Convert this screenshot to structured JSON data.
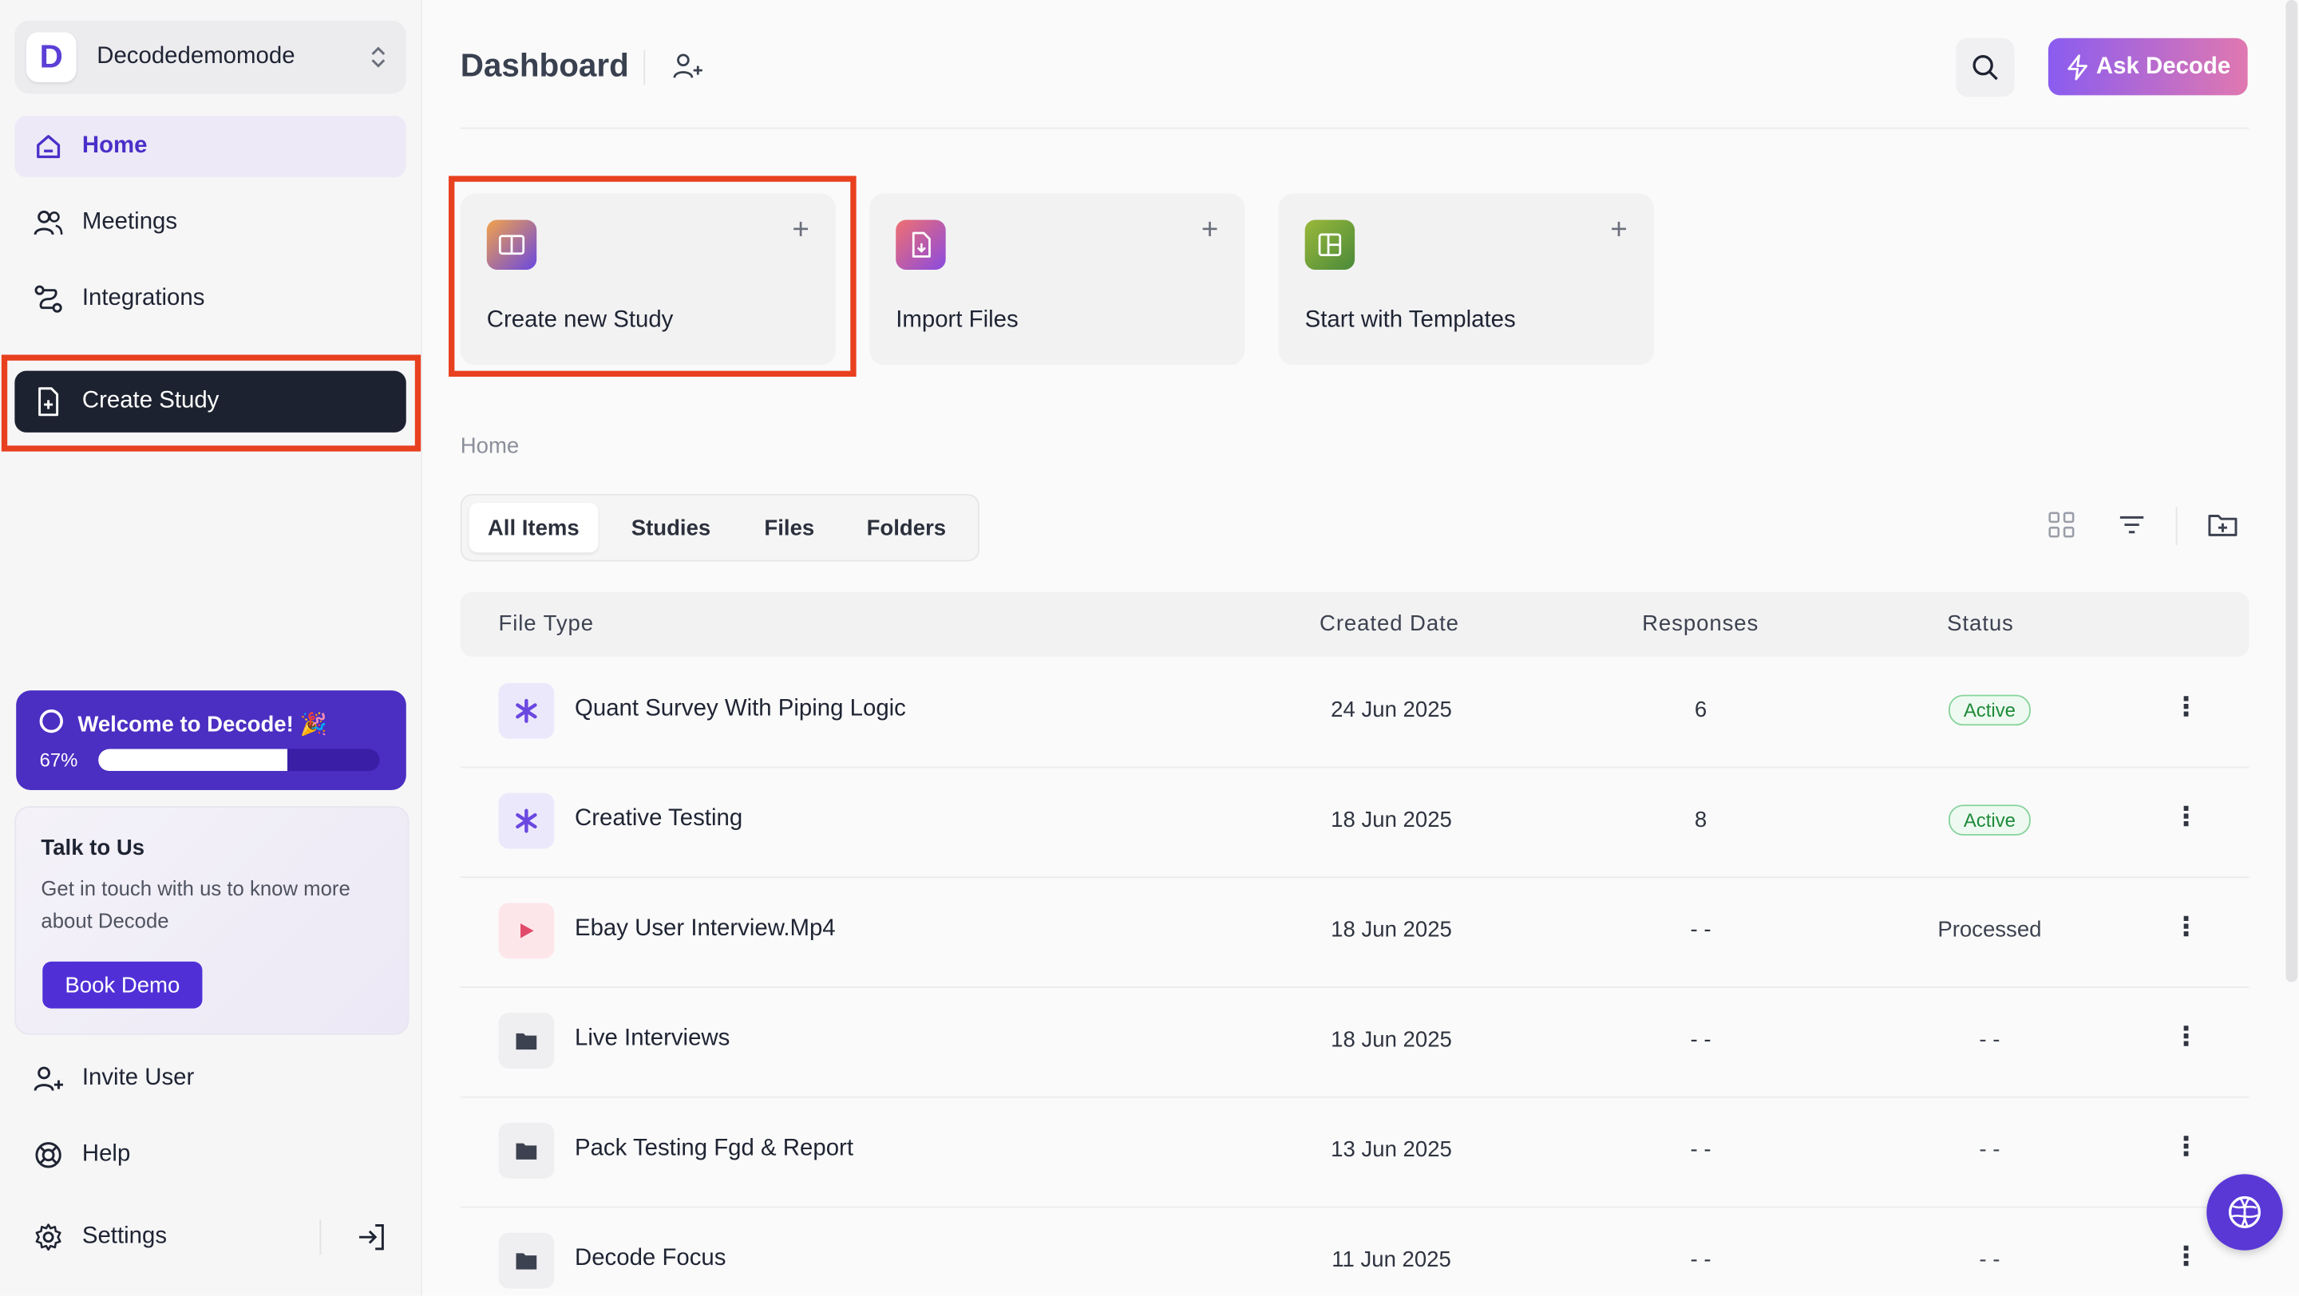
{
  "workspace": {
    "name": "Decodedemomode",
    "logo_letter": "D"
  },
  "nav": {
    "home": "Home",
    "meetings": "Meetings",
    "integrations": "Integrations",
    "create_study": "Create Study"
  },
  "welcome": {
    "title": "Welcome to Decode! 🎉",
    "progress_label": "67%",
    "progress_fraction": 0.67
  },
  "talk": {
    "title": "Talk to Us",
    "text": "Get in touch with us to know more about Decode",
    "button": "Book Demo"
  },
  "bottom_nav": {
    "invite": "Invite User",
    "help": "Help",
    "settings": "Settings"
  },
  "header": {
    "title": "Dashboard",
    "ask_button": "Ask Decode"
  },
  "cards": [
    {
      "label": "Create new Study",
      "plus": "+"
    },
    {
      "label": "Import Files",
      "plus": "+"
    },
    {
      "label": "Start with Templates",
      "plus": "+"
    }
  ],
  "breadcrumb": "Home",
  "tabs": [
    "All Items",
    "Studies",
    "Files",
    "Folders"
  ],
  "table": {
    "headers": {
      "file_type": "File Type",
      "created": "Created Date",
      "responses": "Responses",
      "status": "Status"
    },
    "rows": [
      {
        "name": "Quant Survey With Piping Logic",
        "date": "24 Jun 2025",
        "responses": "6",
        "status": "Active",
        "type": "study"
      },
      {
        "name": "Creative Testing",
        "date": "18 Jun 2025",
        "responses": "8",
        "status": "Active",
        "type": "study"
      },
      {
        "name": "Ebay User Interview.Mp4",
        "date": "18 Jun 2025",
        "responses": "- -",
        "status": "Processed",
        "type": "video"
      },
      {
        "name": "Live Interviews",
        "date": "18 Jun 2025",
        "responses": "- -",
        "status": "- -",
        "type": "folder"
      },
      {
        "name": "Pack Testing Fgd & Report",
        "date": "13 Jun 2025",
        "responses": "- -",
        "status": "- -",
        "type": "folder"
      },
      {
        "name": "Decode Focus",
        "date": "11 Jun 2025",
        "responses": "- -",
        "status": "- -",
        "type": "folder"
      }
    ]
  },
  "colors": {
    "accent": "#5030d6",
    "highlight": "#e8401f",
    "active_badge": "#1f8a3a"
  }
}
